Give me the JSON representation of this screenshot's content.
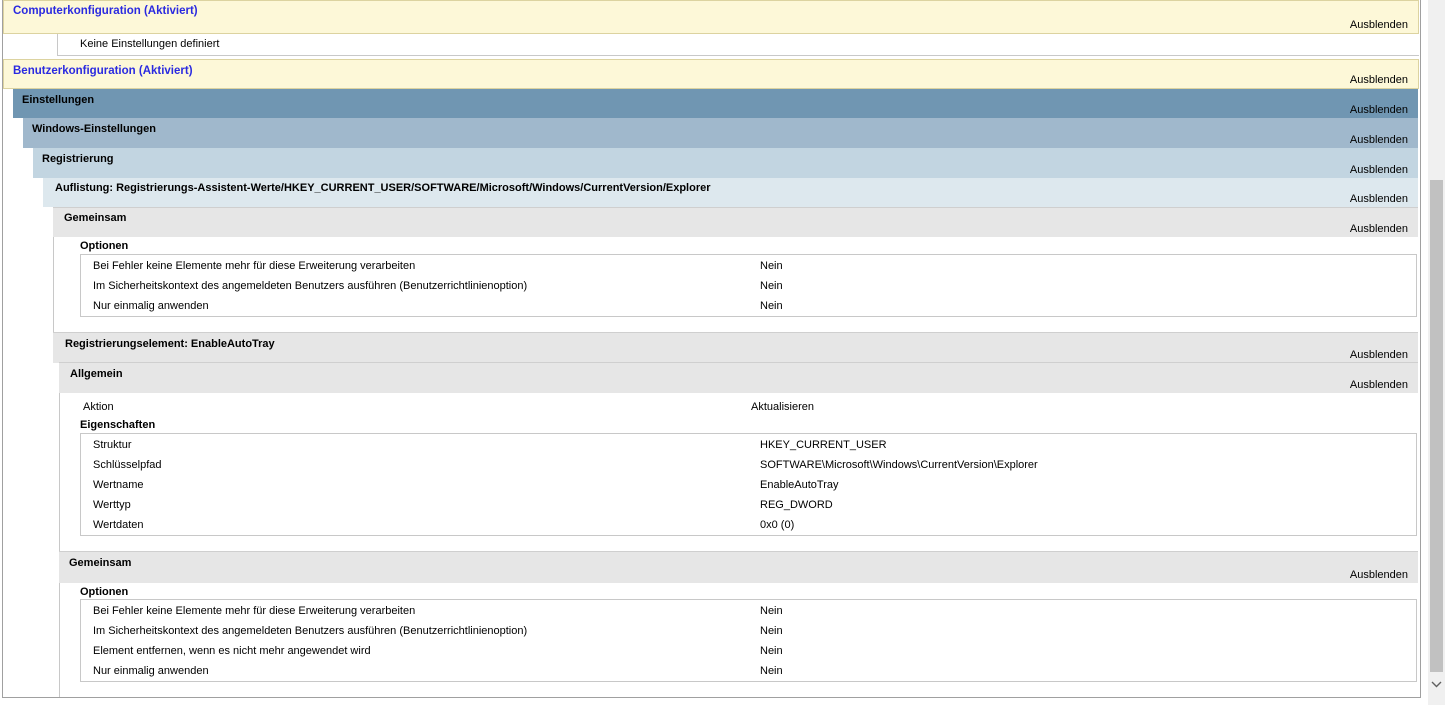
{
  "computer_config": {
    "title": "Computerkonfiguration (Aktiviert)",
    "hide_label": "Ausblenden",
    "no_settings": "Keine Einstellungen definiert"
  },
  "user_config": {
    "title": "Benutzerkonfiguration (Aktiviert)",
    "hide_label": "Ausblenden"
  },
  "settings": {
    "title": "Einstellungen",
    "hide_label": "Ausblenden"
  },
  "windows_settings": {
    "title": "Windows-Einstellungen",
    "hide_label": "Ausblenden"
  },
  "registry": {
    "title": "Registrierung",
    "hide_label": "Ausblenden"
  },
  "listing": {
    "title": "Auflistung: Registrierungs-Assistent-Werte/HKEY_CURRENT_USER/SOFTWARE/Microsoft/Windows/CurrentVersion/Explorer",
    "hide_label": "Ausblenden"
  },
  "common1": {
    "title": "Gemeinsam",
    "hide_label": "Ausblenden",
    "options_label": "Optionen",
    "rows": [
      {
        "label": "Bei Fehler keine Elemente mehr für diese Erweiterung verarbeiten",
        "value": "Nein"
      },
      {
        "label": "Im Sicherheitskontext des angemeldeten Benutzers ausführen (Benutzerrichtlinienoption)",
        "value": "Nein"
      },
      {
        "label": "Nur einmalig anwenden",
        "value": "Nein"
      }
    ]
  },
  "reg_element": {
    "title": "Registrierungselement: EnableAutoTray",
    "hide_label": "Ausblenden"
  },
  "general": {
    "title": "Allgemein",
    "hide_label": "Ausblenden",
    "action_label": "Aktion",
    "action_value": "Aktualisieren",
    "properties_label": "Eigenschaften",
    "rows": [
      {
        "label": "Struktur",
        "value": "HKEY_CURRENT_USER"
      },
      {
        "label": "Schlüsselpfad",
        "value": "SOFTWARE\\Microsoft\\Windows\\CurrentVersion\\Explorer"
      },
      {
        "label": "Wertname",
        "value": "EnableAutoTray"
      },
      {
        "label": "Werttyp",
        "value": "REG_DWORD"
      },
      {
        "label": "Wertdaten",
        "value": "0x0 (0)"
      }
    ]
  },
  "common2": {
    "title": "Gemeinsam",
    "hide_label": "Ausblenden",
    "options_label": "Optionen",
    "rows": [
      {
        "label": "Bei Fehler keine Elemente mehr für diese Erweiterung verarbeiten",
        "value": "Nein"
      },
      {
        "label": "Im Sicherheitskontext des angemeldeten Benutzers ausführen (Benutzerrichtlinienoption)",
        "value": "Nein"
      },
      {
        "label": "Element entfernen, wenn es nicht mehr angewendet wird",
        "value": "Nein"
      },
      {
        "label": "Nur einmalig anwenden",
        "value": "Nein"
      }
    ]
  },
  "scrollbar": {
    "down_icon": "chevron-down-icon"
  }
}
